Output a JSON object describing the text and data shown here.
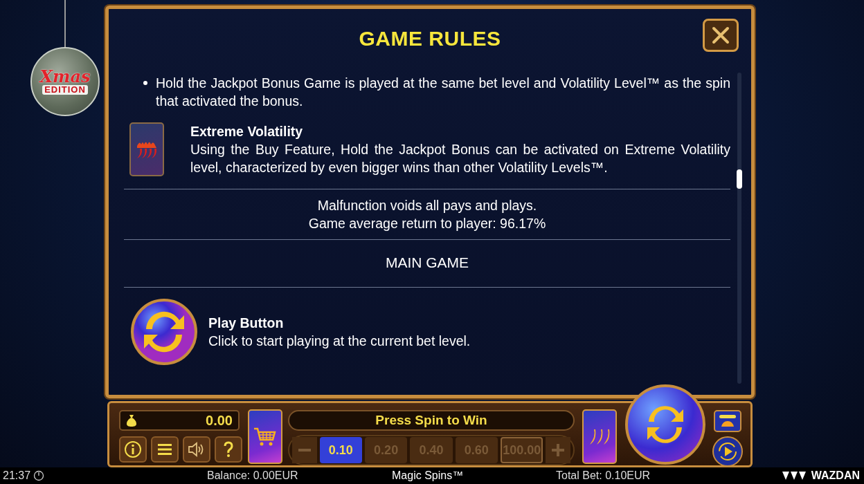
{
  "logo": {
    "line1": "Xmas",
    "line2": "EDITION"
  },
  "rules": {
    "title": "GAME RULES",
    "sections": [
      {
        "kind": "bullet",
        "text": "Hold the Jackpot Bonus Game is played at the same bet level and Volatility Level™ as the spin that activated the bonus."
      },
      {
        "kind": "card-feature",
        "title": "Extreme Volatility",
        "text": "Using the Buy Feature, Hold the Jackpot Bonus can be activated on Extreme Volatility level, characterized by even bigger wins than other Volatility Levels™."
      },
      {
        "kind": "notice",
        "lines": [
          "Malfunction voids all pays and plays.",
          "Game average return to player: 96.17%"
        ]
      },
      {
        "kind": "heading",
        "text": "MAIN GAME"
      },
      {
        "kind": "round-feature",
        "title": "Play Button",
        "text": "Click to start playing at the current bet level."
      }
    ]
  },
  "controls": {
    "balance": "0.00",
    "message": "Press Spin to Win",
    "bets": [
      {
        "value": "0.10",
        "selected": true,
        "outlined": false
      },
      {
        "value": "0.20",
        "selected": false,
        "outlined": false
      },
      {
        "value": "0.40",
        "selected": false,
        "outlined": false
      },
      {
        "value": "0.60",
        "selected": false,
        "outlined": false
      },
      {
        "value": "100.00",
        "selected": false,
        "outlined": true
      }
    ]
  },
  "status_bar": {
    "time": "21:37",
    "balance": "Balance: 0.00EUR",
    "game": "Magic Spins™",
    "total_bet": "Total Bet: 0.10EUR",
    "brand": "WAZDAN"
  }
}
